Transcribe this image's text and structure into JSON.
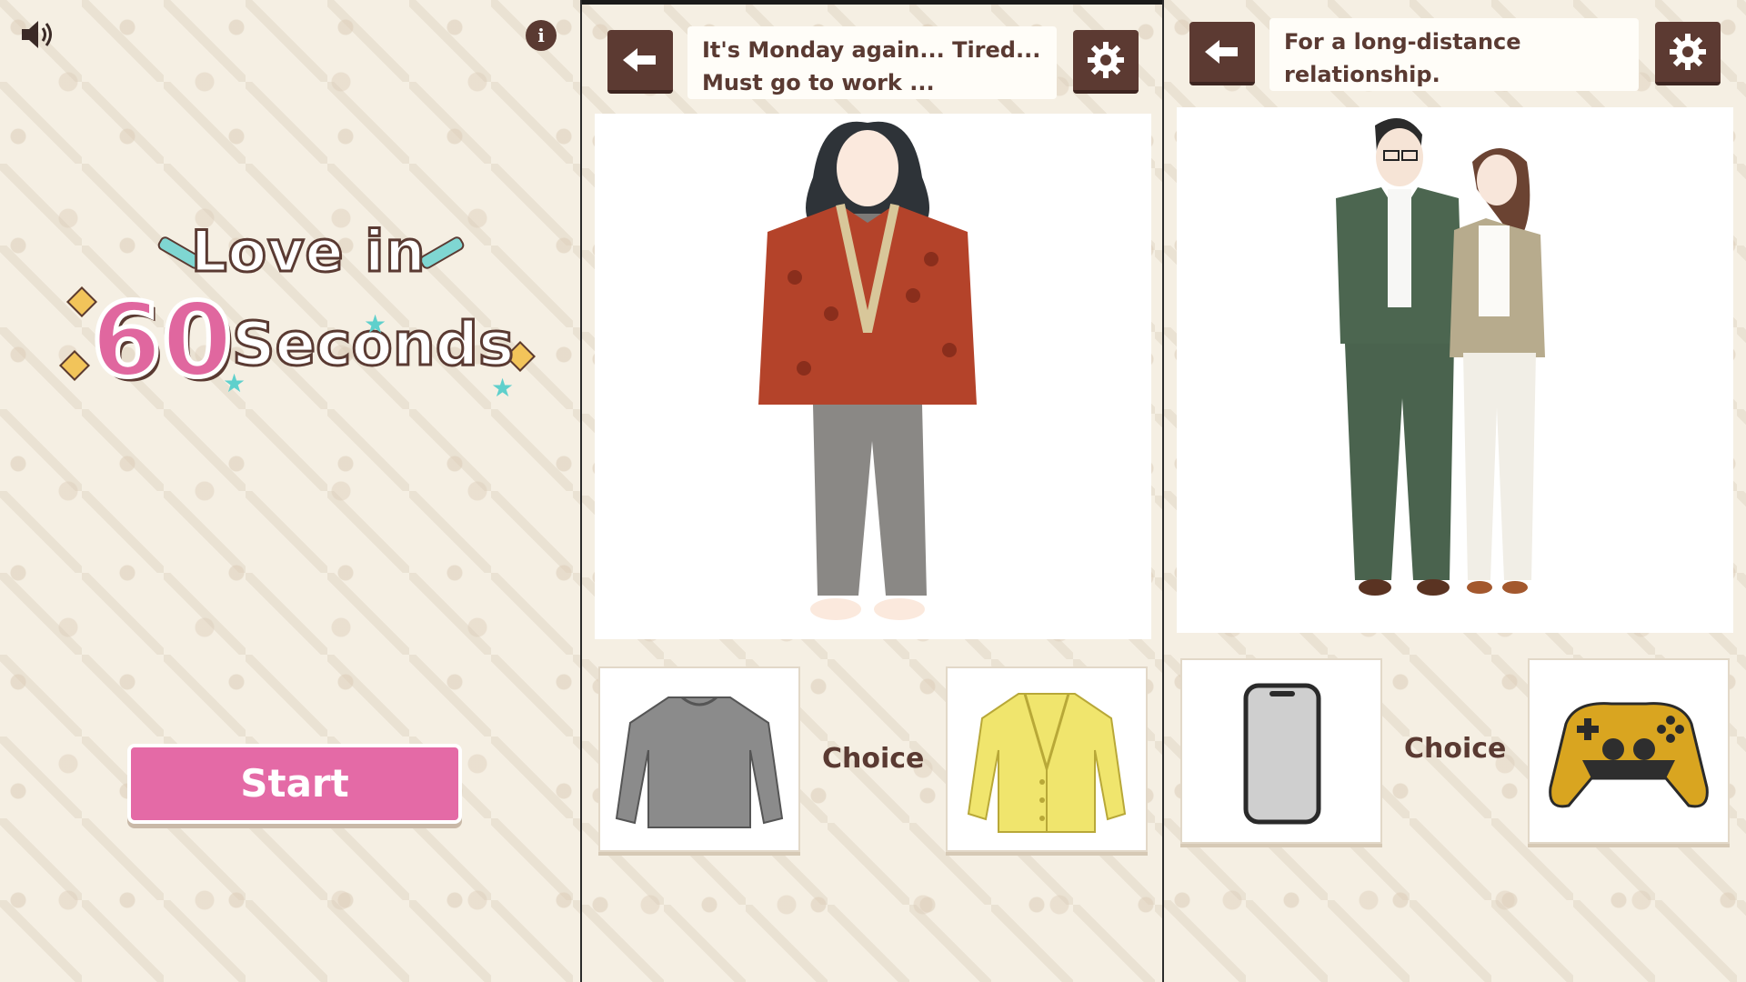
{
  "title_screen": {
    "logo_line1": "Love in",
    "logo_number": "60",
    "logo_word": "Seconds",
    "start_label": "Start",
    "sound_icon": "speaker-icon",
    "info_icon": "info-icon",
    "info_glyph": "i"
  },
  "scene1": {
    "dialog": [
      "It's Monday again... Tired...",
      "Must go to work ..."
    ],
    "choice_label": "Choice",
    "option_left": "gray-sweater-icon",
    "option_right": "yellow-cardigan-icon"
  },
  "scene2": {
    "dialog": [
      "For a long-distance",
      "relationship."
    ],
    "choice_label": "Choice",
    "option_left": "smartphone-icon",
    "option_right": "game-controller-icon"
  },
  "colors": {
    "background": "#f5efe3",
    "button_brown": "#5c3a32",
    "start_pink": "#e46aa6",
    "text_brown": "#5a3a32"
  }
}
